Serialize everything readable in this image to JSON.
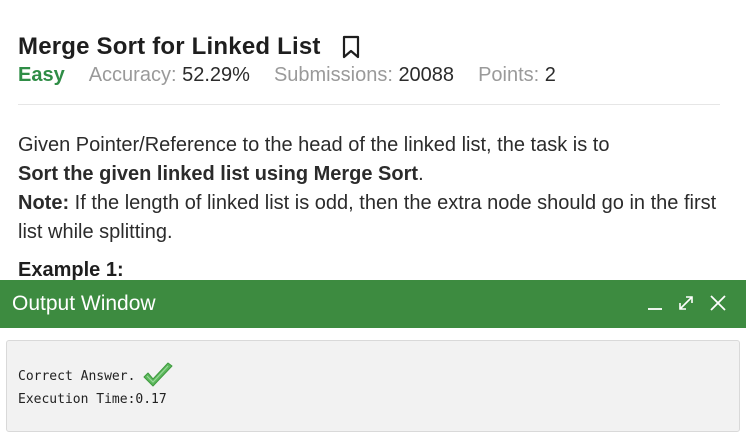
{
  "problem": {
    "title": "Merge Sort for Linked List",
    "difficulty": "Easy",
    "accuracy_label": "Accuracy:",
    "accuracy_value": "52.29%",
    "submissions_label": "Submissions:",
    "submissions_value": "20088",
    "points_label": "Points:",
    "points_value": "2",
    "description_line1": "Given Pointer/Reference to the head of the linked list, the task is to",
    "description_bold": "Sort the given linked list using Merge Sort",
    "description_bold_end": ".",
    "note_label": "Note:",
    "note_text": " If the length of linked list is odd, then the extra node should go in the first list while splitting.",
    "example_label": "Example 1:"
  },
  "output_window": {
    "title": "Output Window",
    "result_text": "Correct Answer.",
    "execution_label": "Execution Time:",
    "execution_value": "0.17"
  },
  "icons": {
    "bookmark": "bookmark-icon",
    "minimize": "minimize-icon",
    "maximize": "expand-icon",
    "close": "close-icon",
    "check": "check-icon"
  },
  "colors": {
    "accent_green": "#2f8d46",
    "header_green": "#3d8b40",
    "check_green": "#5cb85c"
  }
}
